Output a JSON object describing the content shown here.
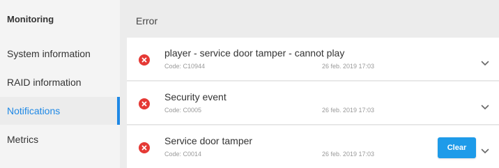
{
  "sidebar": {
    "header": "Monitoring",
    "items": [
      {
        "label": "System information",
        "active": false
      },
      {
        "label": "RAID information",
        "active": false
      },
      {
        "label": "Notifications",
        "active": true
      },
      {
        "label": "Metrics",
        "active": false
      }
    ]
  },
  "main": {
    "section_title": "Error",
    "notifications": [
      {
        "title": "player - service door tamper - cannot play",
        "code": "Code: C10944",
        "date": "26 feb. 2019 17:03",
        "icon": "error-icon"
      },
      {
        "title": "Security event",
        "code": "Code: C0005",
        "date": "26 feb. 2019 17:03",
        "icon": "error-icon"
      },
      {
        "title": "Service door tamper",
        "code": "Code: C0014",
        "date": "26 feb. 2019 17:03",
        "icon": "error-icon",
        "action_label": "Clear"
      }
    ]
  },
  "colors": {
    "accent": "#1e88e5",
    "error": "#e53935",
    "button": "#1e9be9"
  }
}
